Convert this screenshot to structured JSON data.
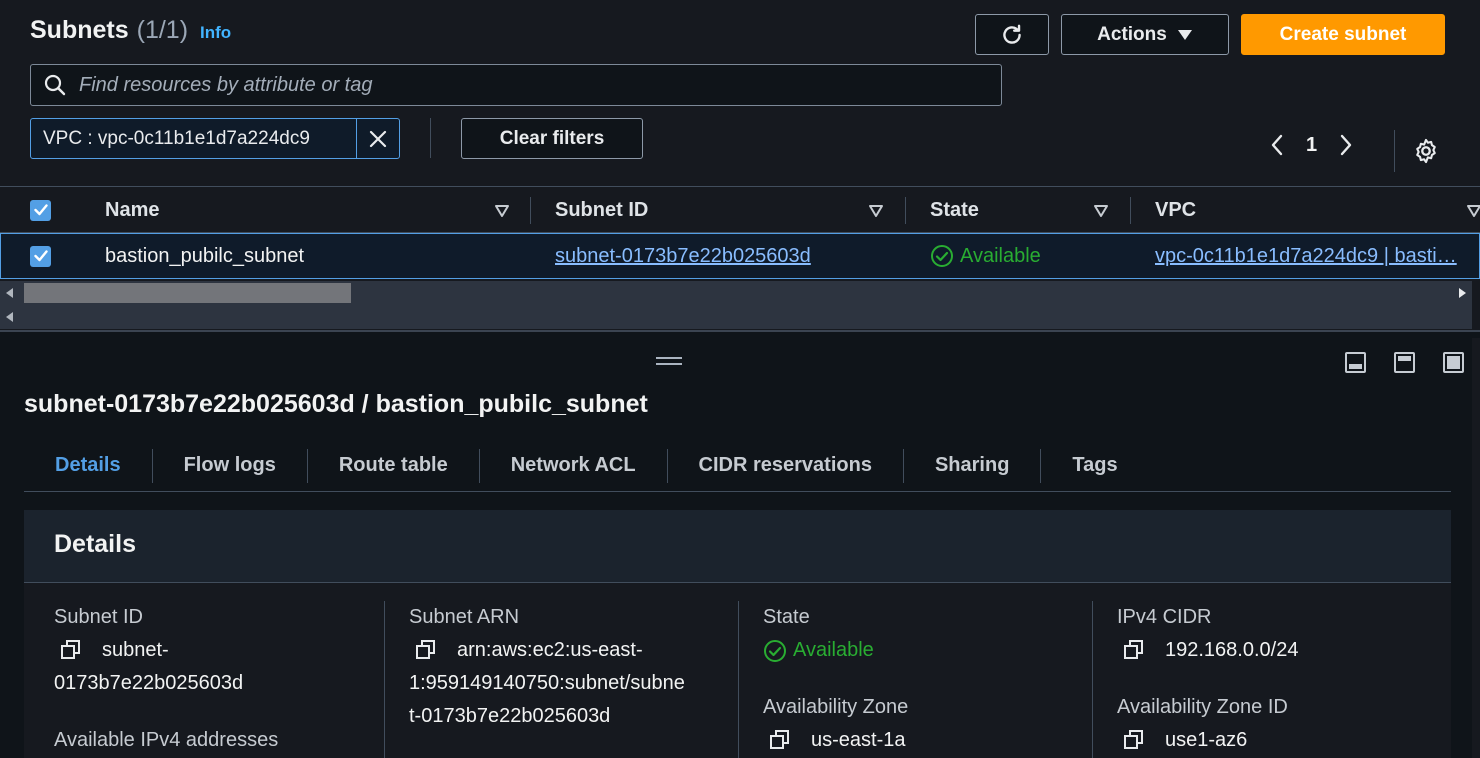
{
  "header": {
    "title": "Subnets",
    "count": "(1/1)",
    "info_link": "Info",
    "refresh_icon": "refresh-icon",
    "actions_label": "Actions",
    "create_label": "Create subnet"
  },
  "search": {
    "placeholder": "Find resources by attribute or tag"
  },
  "filter": {
    "token_label": "VPC : vpc-0c11b1e1d7a224dc9",
    "clear_label": "Clear filters"
  },
  "pagination": {
    "current_page": "1"
  },
  "table": {
    "columns": [
      "Name",
      "Subnet ID",
      "State",
      "VPC"
    ],
    "rows": [
      {
        "name": "bastion_pubilc_subnet",
        "subnet_id": "subnet-0173b7e22b025603d",
        "state": "Available",
        "vpc": "vpc-0c11b1e1d7a224dc9 | basti…"
      }
    ]
  },
  "detail": {
    "title": "subnet-0173b7e22b025603d / bastion_pubilc_subnet",
    "tabs": [
      "Details",
      "Flow logs",
      "Route table",
      "Network ACL",
      "CIDR reservations",
      "Sharing",
      "Tags"
    ],
    "section_title": "Details",
    "fields": {
      "subnet_id_label": "Subnet ID",
      "subnet_id_line1": "subnet-",
      "subnet_id_line2": "0173b7e22b025603d",
      "available_ipv4_label": "Available IPv4 addresses",
      "subnet_arn_label": "Subnet ARN",
      "subnet_arn_line1": "arn:aws:ec2:us-east-",
      "subnet_arn_line2": "1:959149140750:subnet/subne",
      "subnet_arn_line3": "t-0173b7e22b025603d",
      "state_label": "State",
      "state_value": "Available",
      "az_label": "Availability Zone",
      "az_value": "us-east-1a",
      "ipv4_cidr_label": "IPv4 CIDR",
      "ipv4_cidr_value": "192.168.0.0/24",
      "az_id_label": "Availability Zone ID",
      "az_id_value": "use1-az6"
    }
  },
  "colors": {
    "primary_orange": "#ff9900",
    "link_blue": "#89bdff",
    "active_tab_blue": "#539fe5",
    "success_green": "#29ad32"
  }
}
